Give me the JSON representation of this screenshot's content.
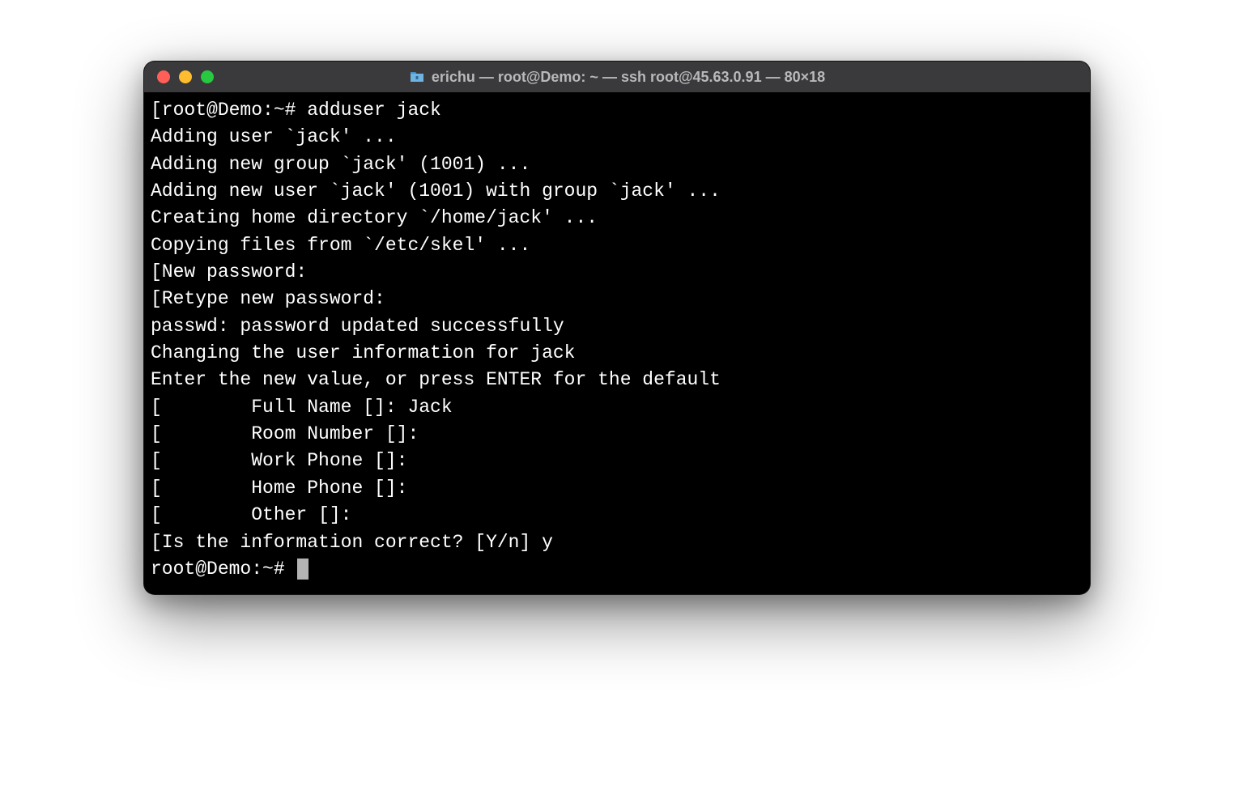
{
  "window": {
    "title": "erichu — root@Demo: ~ — ssh root@45.63.0.91 — 80×18"
  },
  "terminal": {
    "lines": [
      "[root@Demo:~# adduser jack",
      "Adding user `jack' ...",
      "Adding new group `jack' (1001) ...",
      "Adding new user `jack' (1001) with group `jack' ...",
      "Creating home directory `/home/jack' ...",
      "Copying files from `/etc/skel' ...",
      "[New password:",
      "[Retype new password:",
      "passwd: password updated successfully",
      "Changing the user information for jack",
      "Enter the new value, or press ENTER for the default",
      "[        Full Name []: Jack",
      "[        Room Number []:",
      "[        Work Phone []:",
      "[        Home Phone []:",
      "[        Other []:",
      "[Is the information correct? [Y/n] y"
    ],
    "final_prompt": "root@Demo:~# "
  }
}
